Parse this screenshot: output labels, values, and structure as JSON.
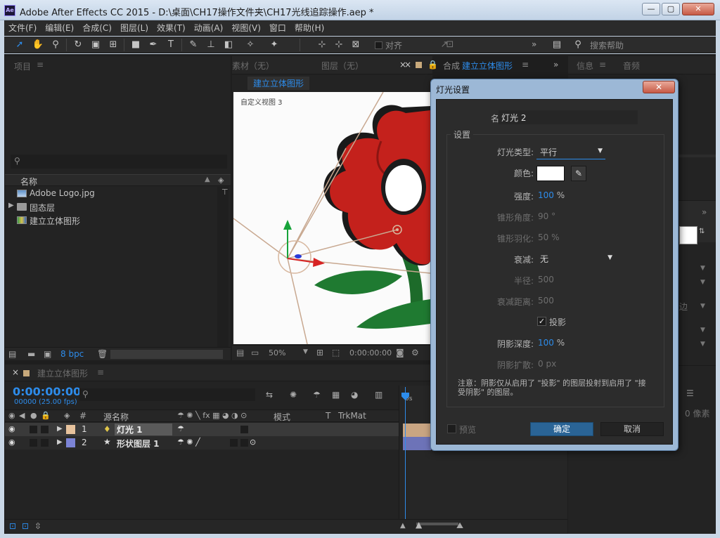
{
  "window": {
    "title": "Adobe After Effects CC 2015 - D:\\桌面\\CH17操作文件夹\\CH17光线追踪操作.aep *",
    "app_icon": "Ae"
  },
  "menu": [
    "文件(F)",
    "编辑(E)",
    "合成(C)",
    "图层(L)",
    "效果(T)",
    "动画(A)",
    "视图(V)",
    "窗口",
    "帮助(H)"
  ],
  "toolbar": {
    "align_label": "对齐",
    "search_help_label": "搜索帮助",
    "more": "»"
  },
  "project_panel": {
    "title": "项目",
    "menu_icon": "≡",
    "column_name": "名称",
    "items": [
      {
        "name": "Adobe Logo.jpg",
        "type": "image"
      },
      {
        "name": "固态层",
        "type": "folder"
      },
      {
        "name": "建立立体图形",
        "type": "composition"
      }
    ],
    "bpc": "8 bpc"
  },
  "viewer_panel": {
    "tabs": [
      "素材（无）",
      "图层（无）",
      "合成"
    ],
    "active_comp": "建立立体图形",
    "comp_tab_label": "建立立体图形",
    "view_label": "自定义视图 3",
    "zoom": "50%",
    "timecode": "0:00:00:00"
  },
  "right_panel": {
    "tabs": [
      "信息",
      "音频"
    ],
    "edge_label": "边",
    "pixels_label": "0 像素"
  },
  "timeline": {
    "comp_name": "建立立体图形",
    "timecode": "0:00:00:00",
    "frame_info": "00000 (25.00 fps)",
    "columns": {
      "num": "#",
      "source_name": "源名称",
      "mode": "模式",
      "t": "T",
      "trkmat": "TrkMat"
    },
    "layers": [
      {
        "num": "1",
        "name": "灯光 1",
        "color": "#e7c39d",
        "type": "light"
      },
      {
        "num": "2",
        "name": "形状图层 1",
        "color": "#7c84d6",
        "type": "shape"
      }
    ],
    "ruler_start": "0s"
  },
  "dialog": {
    "title": "灯光设置",
    "name_label": "名称:",
    "name_value": "灯光 2",
    "settings_group": "设置",
    "light_type_label": "灯光类型:",
    "light_type_value": "平行",
    "color_label": "颜色:",
    "color_value": "#ffffff",
    "intensity_label": "强度:",
    "intensity_value": "100",
    "intensity_unit": "%",
    "cone_angle_label": "锥形角度:",
    "cone_angle_value": "90 °",
    "cone_feather_label": "锥形羽化:",
    "cone_feather_value": "50 %",
    "falloff_label": "衰减:",
    "falloff_value": "无",
    "radius_label": "半径:",
    "radius_value": "500",
    "falloff_distance_label": "衰减距离:",
    "falloff_distance_value": "500",
    "casts_shadows_label": "投影",
    "casts_shadows_checked": true,
    "shadow_darkness_label": "阴影深度:",
    "shadow_darkness_value": "100",
    "shadow_darkness_unit": "%",
    "shadow_diffusion_label": "阴影扩散:",
    "shadow_diffusion_value": "0 px",
    "note": "注意：阴影仅从启用了 \"投影\" 的图层投射到启用了 \"接受阴影\" 的图层。",
    "preview_label": "预览",
    "ok_label": "确定",
    "cancel_label": "取消"
  },
  "colors": {
    "accent_blue": "#2d8ceb",
    "panel_bg": "#232323",
    "dialog_frame": "#9cb8d6",
    "ok_button": "#2a6496"
  }
}
